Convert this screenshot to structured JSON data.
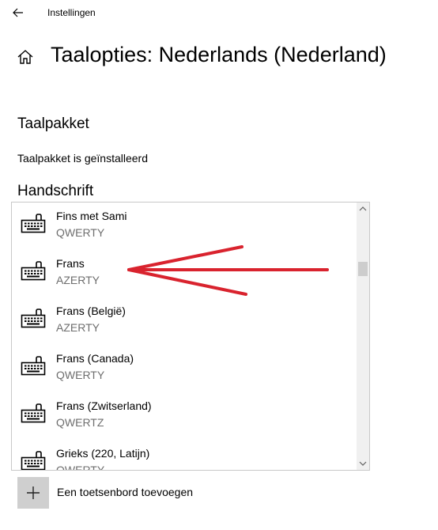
{
  "window": {
    "title": "Instellingen",
    "back_icon": "back-arrow-icon"
  },
  "header": {
    "home_icon": "home-icon",
    "title": "Taalopties: Nederlands (Nederland)"
  },
  "language_pack": {
    "heading": "Taalpakket",
    "status": "Taalpakket is geïnstalleerd"
  },
  "handwriting": {
    "heading": "Handschrift"
  },
  "keyboards": {
    "icon": "keyboard-icon",
    "items": [
      {
        "name": "Fins met Sami",
        "layout": "QWERTY"
      },
      {
        "name": "Frans",
        "layout": "AZERTY"
      },
      {
        "name": "Frans (België)",
        "layout": "AZERTY"
      },
      {
        "name": "Frans (Canada)",
        "layout": "QWERTY"
      },
      {
        "name": "Frans (Zwitserland)",
        "layout": "QWERTZ"
      },
      {
        "name": "Grieks (220, Latijn)",
        "layout": "QWERTY"
      }
    ],
    "scroll_up_icon": "chevron-up-icon",
    "scroll_down_icon": "chevron-down-icon"
  },
  "add_keyboard": {
    "icon": "plus-icon",
    "label": "Een toetsenbord toevoegen"
  },
  "annotation": {
    "color": "#d9232e"
  }
}
